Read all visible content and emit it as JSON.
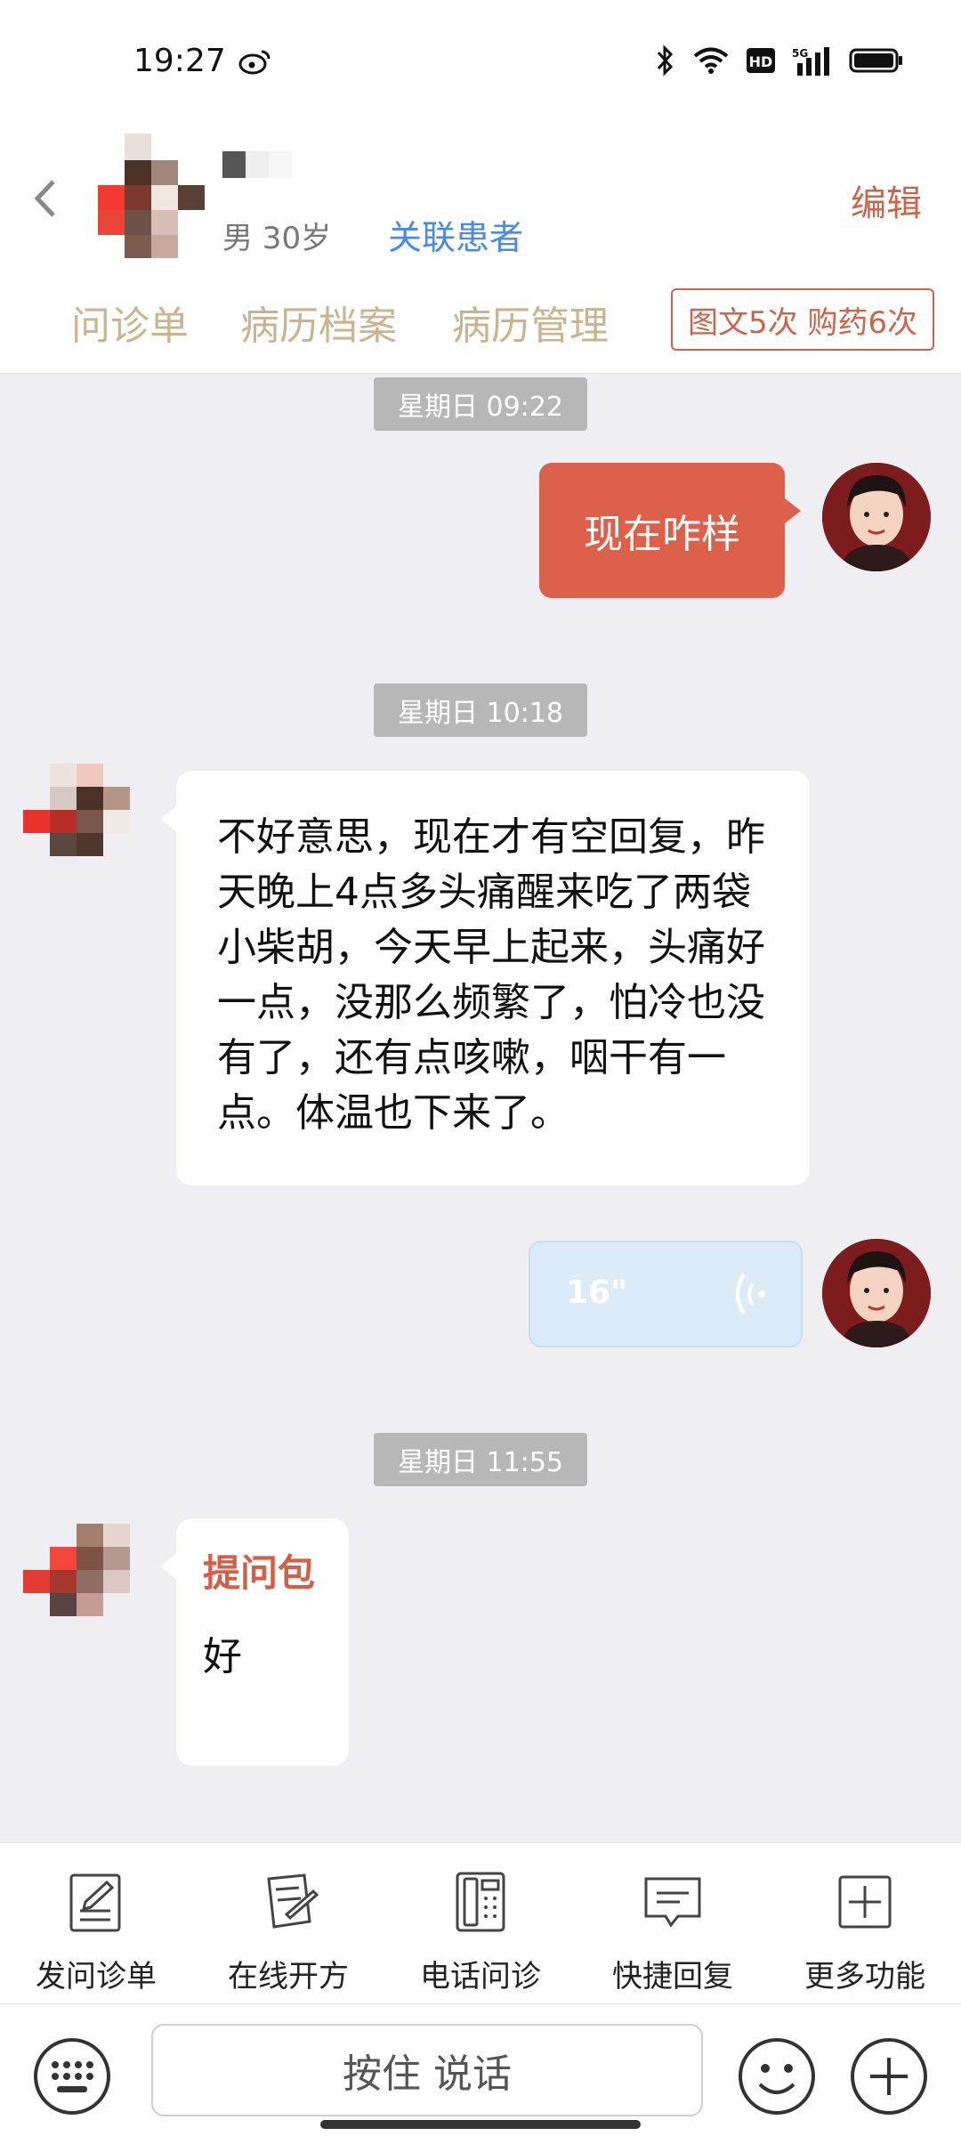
{
  "status_bar": {
    "time": "19:27"
  },
  "header": {
    "patient_meta": "男 30岁",
    "link_patient": "关联患者",
    "edit": "编辑",
    "tabs": [
      {
        "label": "问诊单"
      },
      {
        "label": "病历档案"
      },
      {
        "label": "病历管理"
      }
    ],
    "service_badge": "图文5次 购药6次"
  },
  "chat": {
    "messages": [
      {
        "time": "星期日 09:22",
        "text": "现在咋样"
      },
      {
        "time": "星期日 10:18",
        "text": "不好意思，现在才有空回复，昨天晚上4点多头痛醒来吃了两袋小柴胡，今天早上起来，头痛好一点，没那么频繁了，怕冷也没有了，还有点咳嗽，咽干有一点。体温也下来了。"
      },
      {
        "voice_duration": "16\""
      },
      {
        "time": "星期日 11:55",
        "title": "提问包",
        "text": "好"
      }
    ]
  },
  "functions": [
    {
      "label": "发问诊单",
      "icon": "form-icon"
    },
    {
      "label": "在线开方",
      "icon": "prescription-icon"
    },
    {
      "label": "电话问诊",
      "icon": "phone-icon"
    },
    {
      "label": "快捷回复",
      "icon": "quick-reply-icon"
    },
    {
      "label": "更多功能",
      "icon": "more-icon"
    }
  ],
  "input": {
    "placeholder": "按住 说话"
  },
  "colors": {
    "accent": "#dc604a",
    "link": "#4a8be0",
    "tab": "#c9b48e",
    "voice_bubble": "#dcebf8"
  }
}
